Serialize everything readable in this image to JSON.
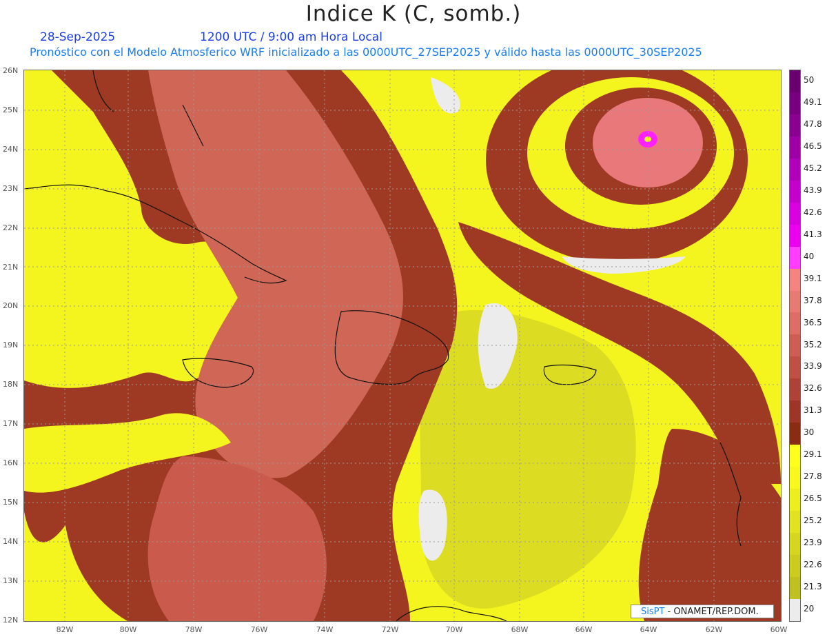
{
  "title": "Indice K (C, somb.)",
  "date": "28-Sep-2025",
  "time": "1200 UTC / 9:00 am Hora Local",
  "forecast_line": "Pronóstico con el Modelo Atmosferico WRF inicializado a las 0000UTC_27SEP2025 y válido hasta las  0000UTC_30SEP2025",
  "lat_labels": [
    "26N",
    "25N",
    "24N",
    "23N",
    "22N",
    "21N",
    "20N",
    "19N",
    "18N",
    "17N",
    "16N",
    "15N",
    "14N",
    "13N",
    "12N"
  ],
  "lon_labels": [
    "82W",
    "80W",
    "78W",
    "76W",
    "74W",
    "72W",
    "70W",
    "68W",
    "66W",
    "64W",
    "62W",
    "60W"
  ],
  "colorbar": {
    "labels": [
      "50",
      "49.1",
      "47.8",
      "46.5",
      "45.2",
      "43.9",
      "42.6",
      "41.3",
      "40",
      "39.1",
      "37.8",
      "36.5",
      "35.2",
      "33.9",
      "32.6",
      "31.3",
      "30",
      "29.1",
      "27.8",
      "26.5",
      "25.2",
      "23.9",
      "22.6",
      "21.3",
      "20"
    ],
    "colors": [
      "#6a0070",
      "#78007e",
      "#8a0090",
      "#9e00a6",
      "#b000ba",
      "#c400cc",
      "#d800de",
      "#ea00ee",
      "#ff3cff",
      "#f48482",
      "#e87a74",
      "#dc6e66",
      "#cc5e54",
      "#be5044",
      "#ae4236",
      "#9e3628",
      "#8a2c12",
      "#ffff1e",
      "#f8f81e",
      "#eeee1e",
      "#e2e220",
      "#d6d620",
      "#cccc20",
      "#c0c020",
      "#ececec"
    ]
  },
  "credit": {
    "brand": "SisPT",
    "org": " - ONAMET/REP.DOM."
  }
}
